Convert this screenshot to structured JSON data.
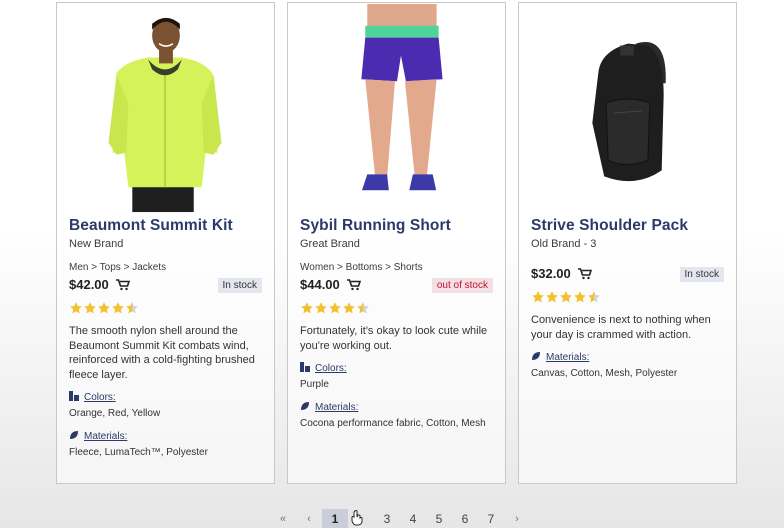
{
  "products": [
    {
      "title": "Beaumont Summit Kit",
      "brand": "New Brand",
      "breadcrumb": "Men > Tops > Jackets",
      "price": "$42.00",
      "stock": "In stock",
      "rating": 4.5,
      "description": "The smooth nylon shell around the Beaumont Summit Kit combats wind, reinforced with a cold-fighting brushed fleece layer.",
      "colors_label": "Colors:",
      "colors": "Orange, Red, Yellow",
      "materials_label": "Materials:",
      "materials": "Fleece, LumaTech™, Polyester"
    },
    {
      "title": "Sybil Running Short",
      "brand": "Great Brand",
      "breadcrumb": "Women > Bottoms > Shorts",
      "price": "$44.00",
      "stock": "out of stock",
      "rating": 4.5,
      "description": "Fortunately, it's okay to look cute while you're working out.",
      "colors_label": "Colors:",
      "colors": "Purple",
      "materials_label": "Materials:",
      "materials": "Cocona performance fabric, Cotton, Mesh"
    },
    {
      "title": "Strive Shoulder Pack",
      "brand": "Old Brand - 3",
      "price": "$32.00",
      "stock": "In stock",
      "rating": 4.5,
      "description": "Convenience is next to nothing when your day is crammed with action.",
      "materials_label": "Materials:",
      "materials": "Canvas, Cotton, Mesh, Polyester"
    }
  ],
  "pagination": {
    "first": "«",
    "prev": "‹",
    "pages": [
      "1",
      "3",
      "4",
      "5",
      "6",
      "7"
    ],
    "current": "1",
    "next": "›"
  },
  "colors": {
    "title": "#2c3a69",
    "star": "#f2c12e",
    "out_of_stock": "#c8102e",
    "in_stock_bg": "#e3e6ee"
  },
  "icons": {
    "cart": "cart-icon",
    "colors": "palette-icon",
    "materials": "leaf-icon",
    "cursor": "hand-cursor-icon"
  }
}
